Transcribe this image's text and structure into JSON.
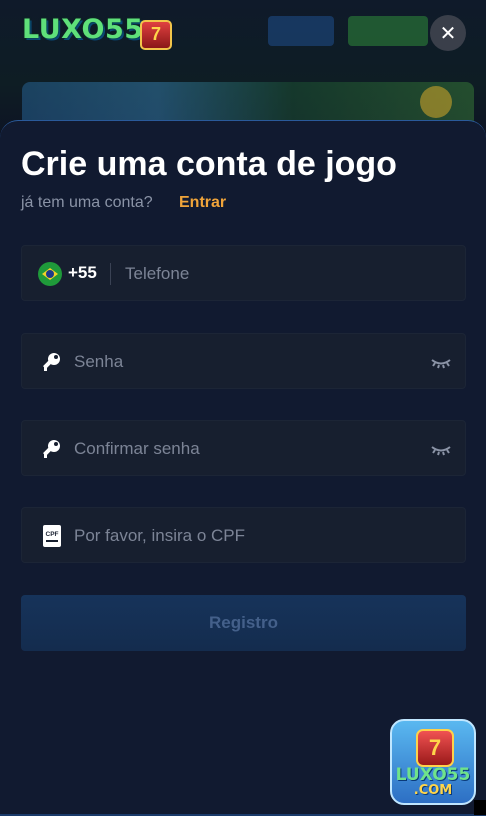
{
  "header": {
    "logo_text": "LUXO55",
    "logo_slot": "7",
    "close_symbol": "✕"
  },
  "modal": {
    "title": "Crie uma conta de jogo",
    "subtitle": "já tem uma conta?",
    "login_link": "Entrar"
  },
  "form": {
    "phone": {
      "country_code": "+55",
      "placeholder": "Telefone",
      "value": ""
    },
    "password": {
      "placeholder": "Senha",
      "value": ""
    },
    "confirm_password": {
      "placeholder": "Confirmar senha",
      "value": ""
    },
    "cpf": {
      "placeholder": "Por favor, insira o CPF",
      "value": "",
      "icon_label": "CPF"
    },
    "register_label": "Registro"
  },
  "app_badge": {
    "slot": "7",
    "brand": "LUXO55",
    "domain": ".COM"
  },
  "icons": {
    "close": "close-icon",
    "flag": "brazil-flag-icon",
    "key": "key-icon",
    "eye": "eye-closed-icon",
    "cpf": "cpf-document-icon"
  },
  "colors": {
    "background": "#0d1324",
    "modal": "#111a30",
    "field": "#171f2f",
    "accent_link": "#f0a43a",
    "button_bg": "#16335a",
    "button_text": "#44608a"
  }
}
